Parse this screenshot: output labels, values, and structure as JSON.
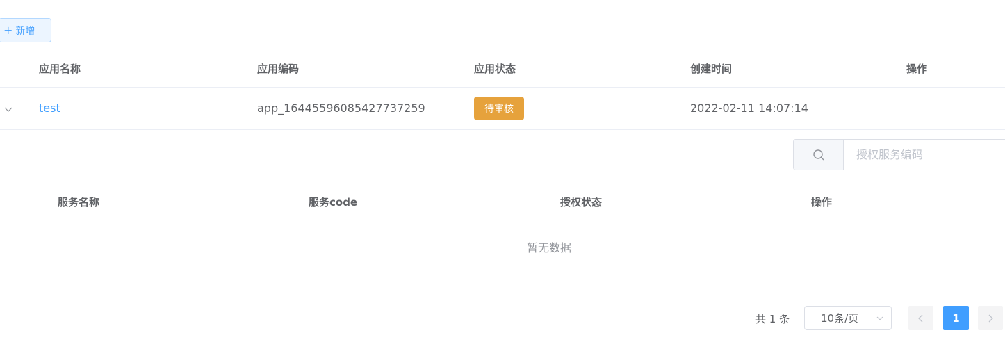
{
  "toolbar": {
    "add_label": "新增"
  },
  "table": {
    "columns": [
      "应用名称",
      "应用编码",
      "应用状态",
      "创建时间",
      "操作"
    ],
    "rows": [
      {
        "name": "test",
        "code": "app_16445596085427737259",
        "status": "待审核",
        "created": "2022-02-11 14:07:14",
        "actions": ""
      }
    ]
  },
  "expanded": {
    "search": {
      "placeholder": "授权服务编码",
      "value": ""
    },
    "columns": [
      "服务名称",
      "服务code",
      "授权状态",
      "操作"
    ],
    "empty_text": "暂无数据"
  },
  "pagination": {
    "total_text": "共 1 条",
    "page_size": "10条/页",
    "current_page": "1"
  },
  "colors": {
    "primary": "#409eff",
    "warning": "#e6a23c",
    "border": "#ebeef5"
  },
  "icons": [
    "plus-icon",
    "expand-chevron-icon",
    "search-icon",
    "chevron-down-icon",
    "prev-page-icon",
    "next-page-icon"
  ]
}
